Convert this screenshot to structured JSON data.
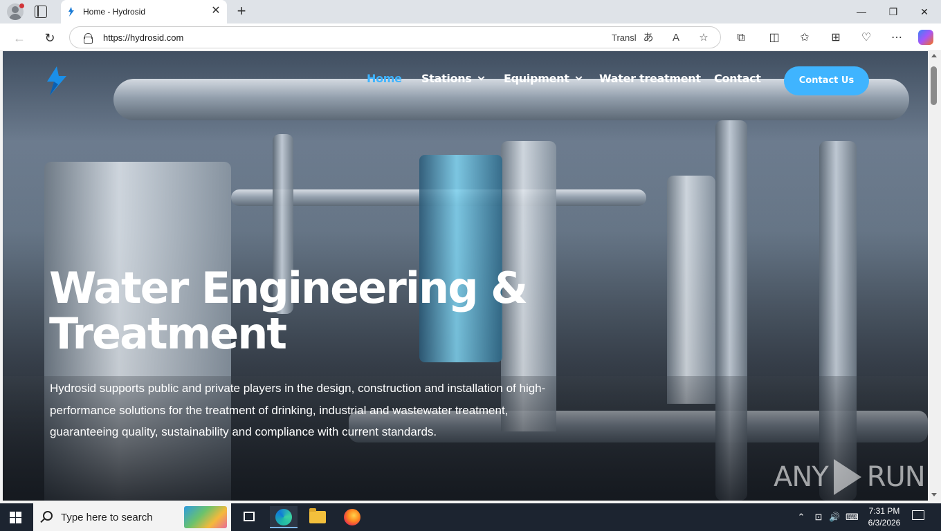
{
  "browser": {
    "tab_title": "Home - Hydrosid",
    "url": "https://hydrosid.com",
    "translate_label": "Transl",
    "new_tab_symbol": "+",
    "tab_close_symbol": "✕",
    "window_controls": {
      "minimize": "—",
      "restore": "❐",
      "close": "✕"
    }
  },
  "site": {
    "nav": {
      "home": "Home",
      "stations": "Stations",
      "equipment": "Equipment",
      "water_treatment": "Water treatment",
      "contact": "Contact"
    },
    "cta_label": "Contact Us",
    "hero": {
      "headline_line1": "Water Engineering &",
      "headline_line2": "Treatment",
      "lead": "Hydrosid supports public and private players in the design, construction and installation of high-performance solutions for the treatment of drinking, industrial and wastewater treatment, guaranteeing quality, sustainability and compliance with current standards."
    },
    "colors": {
      "accent": "#3fb4ff",
      "text": "#ffffff"
    }
  },
  "watermark": {
    "left": "ANY",
    "right": "RUN"
  },
  "taskbar": {
    "search_placeholder": "Type here to search",
    "time": "7:31 PM",
    "date": "6/3/2026"
  },
  "icons": {
    "back": "back-arrow-icon",
    "refresh": "refresh-icon",
    "lock": "lock-icon",
    "translate": "translate-icon",
    "read_aloud": "read-aloud-icon",
    "favorite": "star-icon",
    "extensions": "puzzle-icon",
    "split": "split-screen-icon",
    "favorites": "favorites-icon",
    "collections": "collections-icon",
    "performance": "heart-pulse-icon",
    "more": "ellipsis-icon",
    "copilot": "copilot-icon"
  }
}
